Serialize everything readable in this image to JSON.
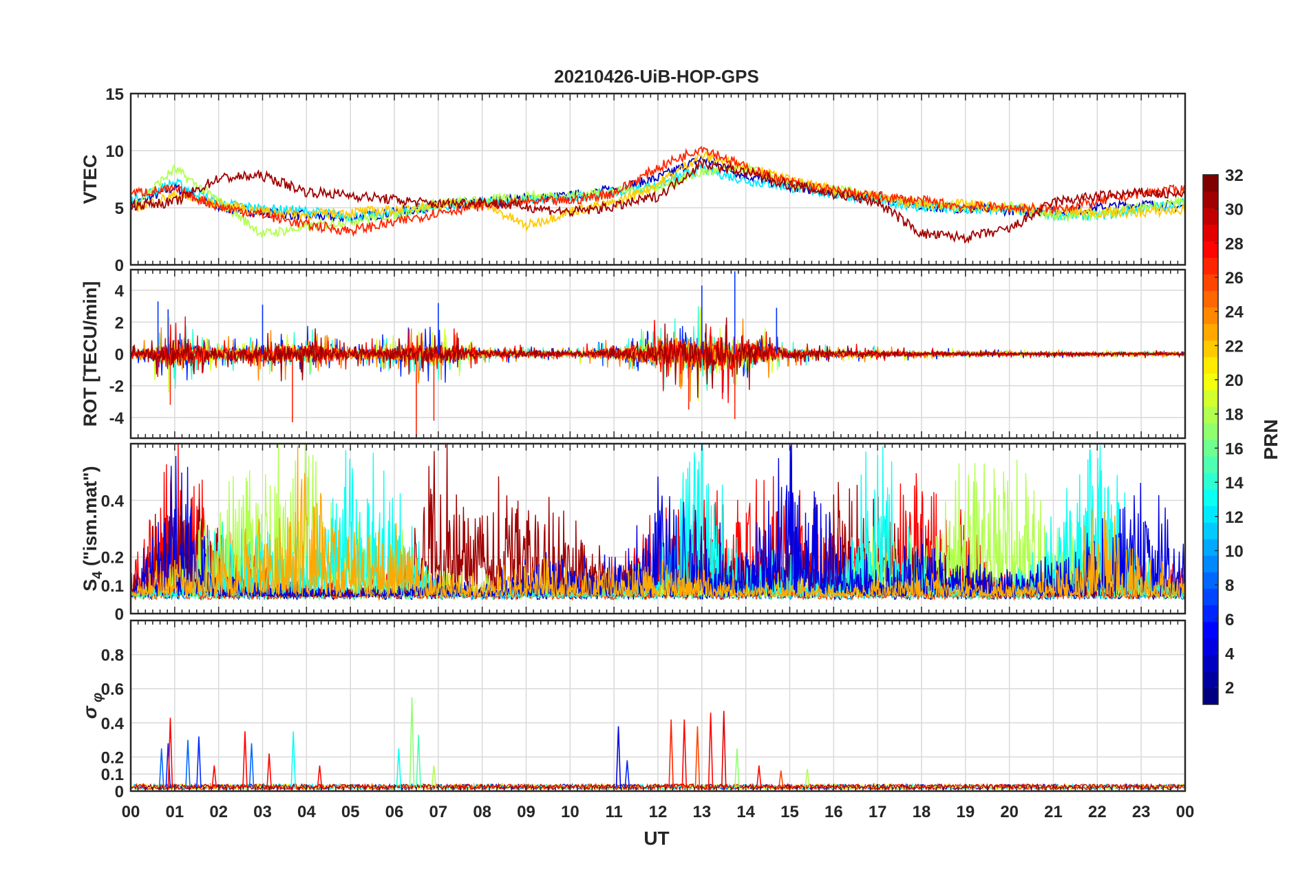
{
  "title": "20210426-UiB-HOP-GPS",
  "x_axis": {
    "label": "UT",
    "ticks": [
      "00",
      "01",
      "02",
      "03",
      "04",
      "05",
      "06",
      "07",
      "08",
      "09",
      "10",
      "11",
      "12",
      "13",
      "14",
      "15",
      "16",
      "17",
      "18",
      "19",
      "20",
      "21",
      "22",
      "23",
      "00"
    ],
    "range_hours": [
      0,
      24
    ]
  },
  "colorbar": {
    "label": "PRN",
    "range": [
      1,
      32
    ],
    "ticks": [
      "2",
      "4",
      "6",
      "8",
      "10",
      "12",
      "14",
      "16",
      "18",
      "20",
      "22",
      "24",
      "26",
      "28",
      "30",
      "32"
    ],
    "colormap": "jet",
    "levels": 32
  },
  "colors": {
    "grid": "#d9d9d9",
    "axis": "#262626",
    "jet_low": "#00008f",
    "jet_mid": "#80ff80",
    "jet_high": "#800000"
  },
  "chart_data": [
    {
      "type": "line",
      "panel": "vtec",
      "ylabel": "VTEC",
      "ylim": [
        0,
        15
      ],
      "yticks": [
        "0",
        "5",
        "10",
        "15"
      ],
      "ytick_values": [
        0,
        5,
        10,
        15
      ],
      "grid": true,
      "x": [
        0,
        1,
        2,
        3,
        4,
        5,
        6,
        7,
        8,
        9,
        10,
        11,
        12,
        13,
        14,
        15,
        16,
        17,
        18,
        19,
        20,
        21,
        22,
        23,
        24
      ],
      "series": [
        {
          "prn": 3,
          "values": [
            5.2,
            6.8,
            5.0,
            4.6,
            4.3,
            4.1,
            4.6,
            5.2,
            5.5,
            5.8,
            6.0,
            6.6,
            7.6,
            9.3,
            7.8,
            6.9,
            6.3,
            5.9,
            5.2,
            4.9,
            4.8,
            4.6,
            5.0,
            5.3,
            5.1
          ]
        },
        {
          "prn": 12,
          "values": [
            5.6,
            7.2,
            5.4,
            4.9,
            4.7,
            4.2,
            4.5,
            5.1,
            5.4,
            5.7,
            5.9,
            6.3,
            7.0,
            8.4,
            7.4,
            6.8,
            6.2,
            5.7,
            5.0,
            4.8,
            4.9,
            4.4,
            4.3,
            4.9,
            5.4
          ]
        },
        {
          "prn": 18,
          "values": [
            5.0,
            8.4,
            5.6,
            2.7,
            3.3,
            3.9,
            4.4,
            5.4,
            5.6,
            6.0,
            6.1,
            6.4,
            6.8,
            8.1,
            8.5,
            7.1,
            6.6,
            6.0,
            5.4,
            5.0,
            5.1,
            4.2,
            4.4,
            5.0,
            5.6
          ]
        },
        {
          "prn": 22,
          "values": [
            4.9,
            6.1,
            5.3,
            4.7,
            4.4,
            4.6,
            4.8,
            5.3,
            5.4,
            3.4,
            4.7,
            5.4,
            7.1,
            9.6,
            8.6,
            7.4,
            6.5,
            5.9,
            5.3,
            5.3,
            5.0,
            4.7,
            4.6,
            4.6,
            4.8
          ]
        },
        {
          "prn": 27,
          "values": [
            6.3,
            6.6,
            5.1,
            4.4,
            3.5,
            3.0,
            3.7,
            4.6,
            5.2,
            5.5,
            5.6,
            6.3,
            8.5,
            10.3,
            8.5,
            7.2,
            6.5,
            6.0,
            5.6,
            5.1,
            5.0,
            4.9,
            5.5,
            6.3,
            6.6
          ]
        },
        {
          "prn": 31,
          "values": [
            5.2,
            5.5,
            7.6,
            7.8,
            6.4,
            6.1,
            5.7,
            5.3,
            5.5,
            5.1,
            4.6,
            5.1,
            6.0,
            8.9,
            8.1,
            7.0,
            6.2,
            5.5,
            2.7,
            2.4,
            3.1,
            5.5,
            6.0,
            6.3,
            6.1
          ]
        }
      ]
    },
    {
      "type": "line",
      "panel": "rot",
      "ylabel": "ROT [TECU/min]",
      "ylim": [
        -5.3,
        5.3
      ],
      "yticks": [
        "-4",
        "-2",
        "0",
        "2",
        "4"
      ],
      "ytick_values": [
        -4,
        -2,
        0,
        2,
        4
      ],
      "grid": true,
      "x": [
        0,
        1,
        2,
        3,
        4,
        5,
        6,
        7,
        8,
        9,
        10,
        11,
        12,
        13,
        14,
        15,
        16,
        17,
        18,
        19,
        20,
        21,
        22,
        23,
        24
      ],
      "noise_amplitude": [
        0.5,
        2.8,
        1.3,
        1.8,
        2.2,
        1.0,
        1.6,
        2.4,
        0.8,
        0.7,
        0.5,
        1.2,
        2.6,
        4.1,
        2.8,
        1.0,
        0.7,
        0.6,
        0.4,
        0.4,
        0.3,
        0.3,
        0.3,
        0.3,
        0.3
      ],
      "peaks": [
        {
          "x": 0.62,
          "y": 3.3
        },
        {
          "x": 0.85,
          "y": 2.8
        },
        {
          "x": 0.9,
          "y": -3.2
        },
        {
          "x": 3.0,
          "y": 3.1
        },
        {
          "x": 3.68,
          "y": -4.3
        },
        {
          "x": 6.5,
          "y": -5.2
        },
        {
          "x": 6.9,
          "y": -4.2
        },
        {
          "x": 7.0,
          "y": 3.2
        },
        {
          "x": 13.0,
          "y": 4.3
        },
        {
          "x": 13.75,
          "y": 5.2
        },
        {
          "x": 13.75,
          "y": -4.1
        },
        {
          "x": 14.7,
          "y": 2.9
        },
        {
          "x": 12.7,
          "y": -3.5
        }
      ]
    },
    {
      "type": "line",
      "panel": "s4",
      "ylabel": "S4 (\"ism.mat\")",
      "ylim": [
        0,
        0.6
      ],
      "yticks": [
        "0",
        "0.1",
        "0.2",
        "0.4"
      ],
      "ytick_values": [
        0,
        0.1,
        0.2,
        0.4
      ],
      "grid": true,
      "x": [
        0,
        1,
        2,
        3,
        4,
        5,
        6,
        7,
        8,
        9,
        10,
        11,
        12,
        13,
        14,
        15,
        16,
        17,
        18,
        19,
        20,
        21,
        22,
        23,
        24
      ],
      "series_peaks": [
        {
          "prn": 28,
          "values": [
            0.2,
            0.55,
            0.3,
            0.2,
            0.12,
            0.1,
            0.14,
            0.1,
            0.09,
            0.15,
            0.14,
            0.2,
            0.33,
            0.36,
            0.45,
            0.4,
            0.3,
            0.2,
            0.58,
            0.3,
            0.14,
            0.12,
            0.2,
            0.15,
            0.16
          ]
        },
        {
          "prn": 31,
          "values": [
            0.15,
            0.45,
            0.25,
            0.12,
            0.1,
            0.09,
            0.12,
            0.58,
            0.4,
            0.35,
            0.3,
            0.18,
            0.2,
            0.32,
            0.15,
            0.3,
            0.4,
            0.38,
            0.22,
            0.18,
            0.1,
            0.15,
            0.18,
            0.12,
            0.14
          ]
        },
        {
          "prn": 18,
          "values": [
            0.08,
            0.15,
            0.4,
            0.45,
            0.58,
            0.3,
            0.25,
            0.15,
            0.12,
            0.14,
            0.1,
            0.12,
            0.2,
            0.18,
            0.12,
            0.15,
            0.1,
            0.3,
            0.2,
            0.5,
            0.55,
            0.28,
            0.25,
            0.14,
            0.1
          ]
        },
        {
          "prn": 13,
          "values": [
            0.07,
            0.1,
            0.3,
            0.32,
            0.2,
            0.58,
            0.4,
            0.1,
            0.08,
            0.09,
            0.07,
            0.1,
            0.2,
            0.58,
            0.18,
            0.2,
            0.14,
            0.58,
            0.2,
            0.1,
            0.12,
            0.3,
            0.58,
            0.2,
            0.08
          ]
        },
        {
          "prn": 4,
          "values": [
            0.08,
            0.5,
            0.15,
            0.1,
            0.09,
            0.08,
            0.1,
            0.14,
            0.1,
            0.18,
            0.2,
            0.2,
            0.45,
            0.3,
            0.2,
            0.58,
            0.3,
            0.15,
            0.25,
            0.18,
            0.15,
            0.2,
            0.25,
            0.45,
            0.25
          ]
        },
        {
          "prn": 23,
          "values": [
            0.1,
            0.2,
            0.2,
            0.3,
            0.5,
            0.25,
            0.28,
            0.15,
            0.12,
            0.18,
            0.14,
            0.15,
            0.18,
            0.15,
            0.1,
            0.12,
            0.1,
            0.12,
            0.15,
            0.12,
            0.1,
            0.14,
            0.35,
            0.2,
            0.12
          ]
        }
      ]
    },
    {
      "type": "line",
      "panel": "sigma_phi",
      "ylabel": "σ φ",
      "ylim": [
        0,
        1
      ],
      "yticks": [
        "0",
        "0.1",
        "0.2",
        "0.4",
        "0.6",
        "0.8"
      ],
      "ytick_values": [
        0,
        0.1,
        0.2,
        0.4,
        0.6,
        0.8
      ],
      "grid": true,
      "spikes": [
        {
          "x": 0.7,
          "y": 0.25,
          "prn": 8
        },
        {
          "x": 0.85,
          "y": 0.28,
          "prn": 6
        },
        {
          "x": 0.9,
          "y": 0.43,
          "prn": 28
        },
        {
          "x": 1.3,
          "y": 0.3,
          "prn": 8
        },
        {
          "x": 1.55,
          "y": 0.32,
          "prn": 6
        },
        {
          "x": 1.9,
          "y": 0.15,
          "prn": 28
        },
        {
          "x": 2.6,
          "y": 0.35,
          "prn": 28
        },
        {
          "x": 2.75,
          "y": 0.28,
          "prn": 8
        },
        {
          "x": 3.15,
          "y": 0.22,
          "prn": 28
        },
        {
          "x": 3.7,
          "y": 0.35,
          "prn": 13
        },
        {
          "x": 4.3,
          "y": 0.15,
          "prn": 28
        },
        {
          "x": 6.4,
          "y": 0.55,
          "prn": 17
        },
        {
          "x": 6.55,
          "y": 0.33,
          "prn": 15
        },
        {
          "x": 6.1,
          "y": 0.25,
          "prn": 13
        },
        {
          "x": 6.9,
          "y": 0.15,
          "prn": 18
        },
        {
          "x": 11.1,
          "y": 0.38,
          "prn": 4
        },
        {
          "x": 11.3,
          "y": 0.18,
          "prn": 6
        },
        {
          "x": 12.3,
          "y": 0.42,
          "prn": 27
        },
        {
          "x": 12.6,
          "y": 0.42,
          "prn": 28
        },
        {
          "x": 12.9,
          "y": 0.38,
          "prn": 26
        },
        {
          "x": 13.2,
          "y": 0.46,
          "prn": 28
        },
        {
          "x": 13.5,
          "y": 0.47,
          "prn": 29
        },
        {
          "x": 13.8,
          "y": 0.25,
          "prn": 17
        },
        {
          "x": 14.3,
          "y": 0.15,
          "prn": 28
        },
        {
          "x": 14.8,
          "y": 0.12,
          "prn": 26
        },
        {
          "x": 15.4,
          "y": 0.13,
          "prn": 18
        }
      ]
    }
  ]
}
